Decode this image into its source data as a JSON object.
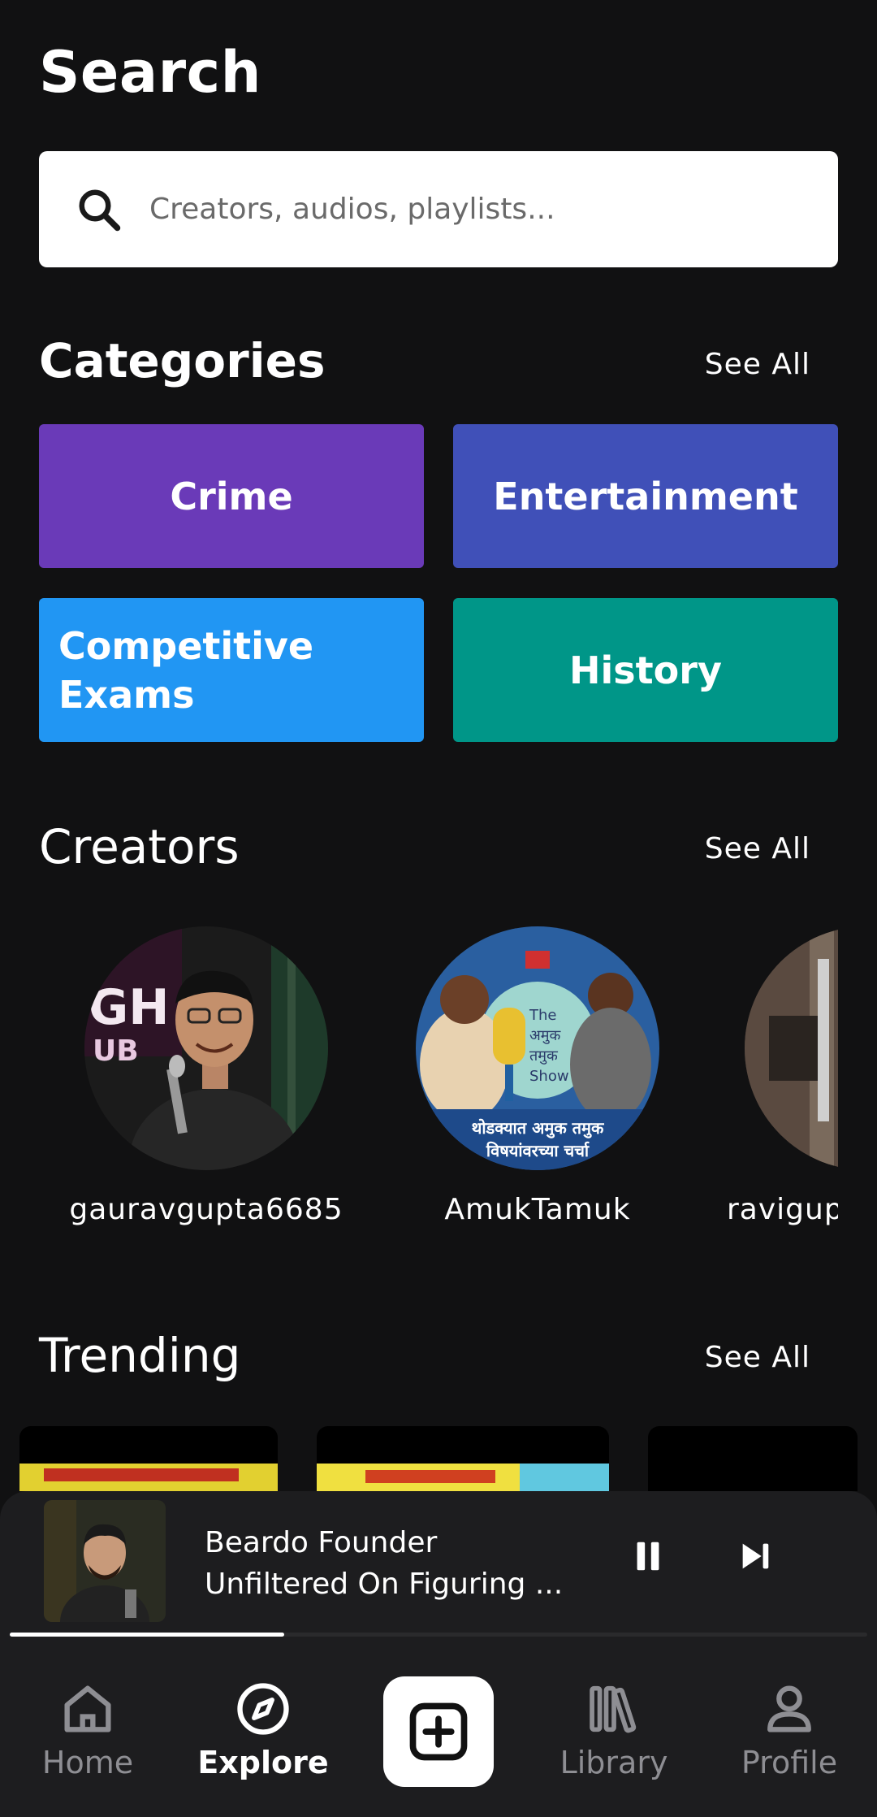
{
  "header": {
    "title": "Search"
  },
  "search": {
    "placeholder": "Creators, audios, playlists..."
  },
  "categories": {
    "title": "Categories",
    "see_all": "See All",
    "items": [
      {
        "label": "Crime",
        "color": "#6a3ab8"
      },
      {
        "label": "Entertainment",
        "color": "#4050b8"
      },
      {
        "label": "Competitive Exams",
        "color": "#2196f3"
      },
      {
        "label": "History",
        "color": "#009688"
      }
    ]
  },
  "creators": {
    "title": "Creators",
    "see_all": "See All",
    "items": [
      {
        "name": "gauravgupta6685"
      },
      {
        "name": "AmukTamuk"
      },
      {
        "name": "ravigup"
      }
    ]
  },
  "trending": {
    "title": "Trending",
    "see_all": "See All"
  },
  "now_playing": {
    "title_line1": "Beardo Founder",
    "title_line2": "Unfiltered On Figuring ...",
    "progress": 0.32
  },
  "bottom_nav": {
    "items": [
      {
        "label": "Home",
        "icon": "home-icon",
        "active": false
      },
      {
        "label": "Explore",
        "icon": "compass-icon",
        "active": true
      },
      {
        "label": "",
        "icon": "plus-square-icon",
        "active": false
      },
      {
        "label": "Library",
        "icon": "library-icon",
        "active": false
      },
      {
        "label": "Profile",
        "icon": "user-icon",
        "active": false
      }
    ]
  }
}
